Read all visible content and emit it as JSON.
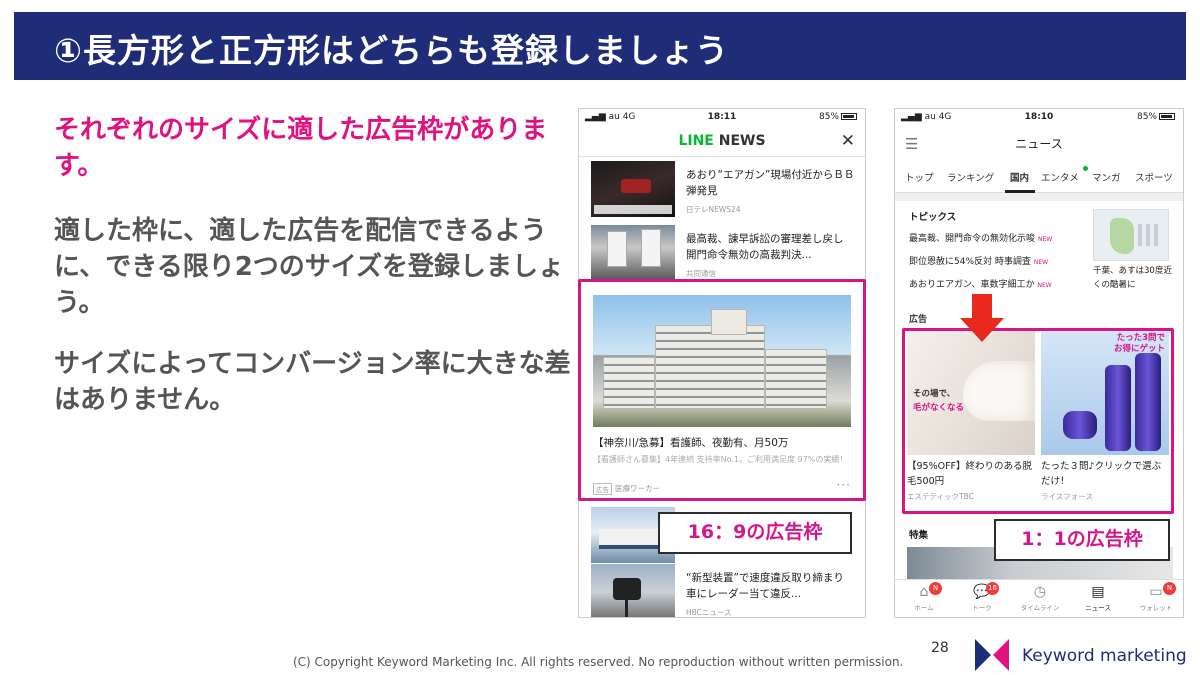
{
  "slide": {
    "title": "①長方形と正方形はどちらも登録しましょう",
    "lead": "それぞれのサイズに適した広告枠があります。",
    "para1": "適した枠に、適した広告を配信できるように、できる限り2つのサイズを登録しましょう。",
    "para2": "サイズによってコンバージョン率に大きな差はありません。"
  },
  "phone1": {
    "status": {
      "carrier": "au  4G",
      "time": "18:11",
      "battery": "85%"
    },
    "logo_line": "LINE",
    "logo_news": " NEWS",
    "close": "✕",
    "news": [
      {
        "title": "あおり“エアガン”現場付近からＢＢ弾発見",
        "source": "日テレNEWS24"
      },
      {
        "title": "最高裁、諌早訴訟の審理差し戻し　開門命令無効の高裁判決...",
        "source": "共同通信"
      },
      {
        "title": "“新型装置”で速度違反取り締まり　車にレーダー当て違反...",
        "source": "HBCニュース"
      }
    ],
    "ad": {
      "title": "【神奈川/急募】看護師、夜勤有、月50万",
      "desc": "【看護師さん募集】4年連続 支持率No.1。ご利用満足度 97%の実績！",
      "tag": "広告",
      "sponsor": "医療ワーカー",
      "more": "···"
    },
    "label": "16：9の広告枠"
  },
  "phone2": {
    "status": {
      "carrier": "au  4G",
      "time": "18:10",
      "battery": "85%"
    },
    "menu": "☰",
    "title": "ニュース",
    "tabs": [
      "トップ",
      "ランキング",
      "国内",
      "エンタメ",
      "マンガ",
      "スポーツ"
    ],
    "topics_header": "トピックス",
    "topics": [
      {
        "text": "最高裁、開門命令の無効化示唆",
        "badge": "NEW"
      },
      {
        "text": "即位恩赦に54%反対 時事調査",
        "badge": "NEW"
      },
      {
        "text": "あおりエアガン、車数字細工か",
        "badge": "NEW"
      }
    ],
    "weather_caption": "千葉、あすは30度近くの酷暑に",
    "ad_header": "広告",
    "ads": [
      {
        "img_text_1": "その場で、",
        "img_text_2": "毛がなくなる",
        "title": "【95%OFF】終わりのある脱毛500円",
        "source": "エステティックTBC"
      },
      {
        "img_text": "たった3問でお得にゲット",
        "title": "たった３問♪クリックで選ぶだけ！",
        "source": "ライスフォース"
      }
    ],
    "feature_header": "特集",
    "nav": [
      {
        "label": "ホーム",
        "icon": "⌂",
        "badge": "N"
      },
      {
        "label": "トーク",
        "icon": "💬",
        "badge": "16"
      },
      {
        "label": "タイムライン",
        "icon": "◷",
        "badge": ""
      },
      {
        "label": "ニュース",
        "icon": "▤",
        "badge": ""
      },
      {
        "label": "ウォレット",
        "icon": "▭",
        "badge": "N"
      }
    ],
    "label": "1：1の広告枠"
  },
  "footer": {
    "copyright": "(C) Copyright Keyword Marketing Inc. All rights reserved. No reproduction without written permission.",
    "page": "28",
    "brand": "Keyword marketing"
  },
  "colors": {
    "title_bar": "#1f2d78",
    "accent": "#e0127f",
    "frame": "#d4168a",
    "arrow": "#e8291c"
  }
}
